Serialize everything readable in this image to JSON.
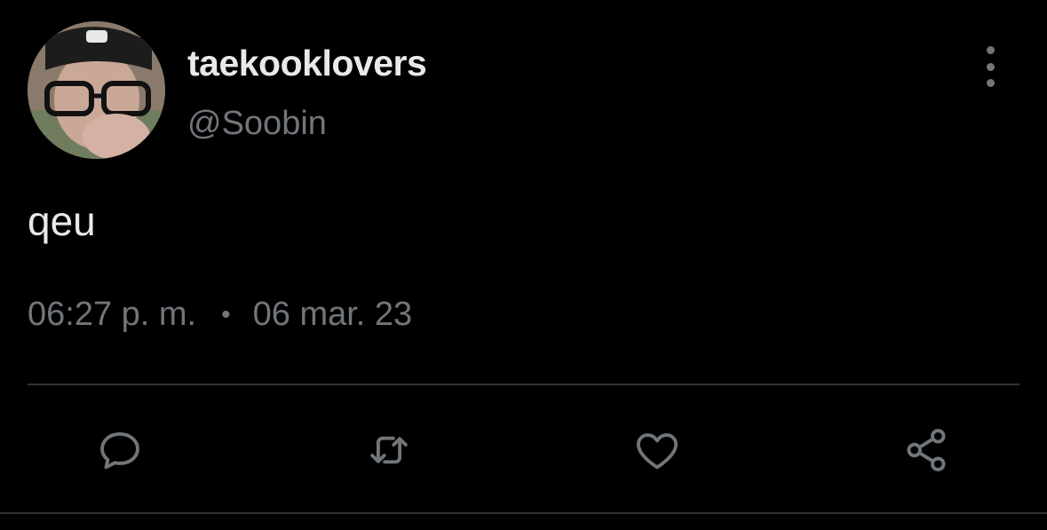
{
  "tweet": {
    "author": {
      "display_name": "taekooklovers",
      "handle": "@Soobin",
      "avatar_icon": "profile-photo"
    },
    "text": "qeu",
    "time": "06:27 p. m.",
    "separator": "•",
    "date": "06 mar. 23"
  },
  "actions": [
    {
      "name": "reply",
      "icon": "speech-bubble-icon"
    },
    {
      "name": "retweet",
      "icon": "retweet-arrows-icon"
    },
    {
      "name": "like",
      "icon": "heart-icon"
    },
    {
      "name": "share",
      "icon": "share-nodes-icon"
    }
  ],
  "colors": {
    "background": "#000000",
    "primary_text": "#e7e9ea",
    "secondary_text": "#71767b",
    "divider": "#2f3336"
  }
}
